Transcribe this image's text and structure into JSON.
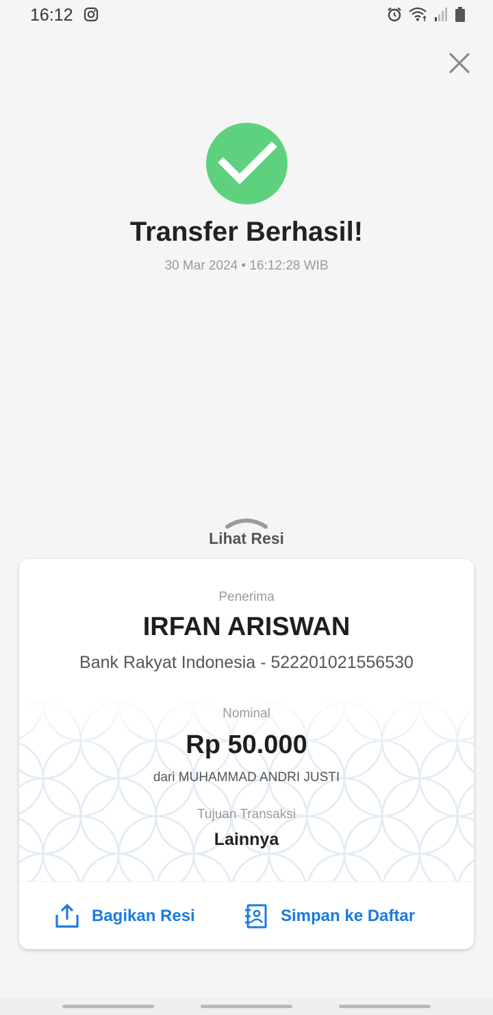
{
  "status_bar": {
    "time": "16:12",
    "icons": [
      "instagram-icon",
      "alarm-icon",
      "wifi-icon",
      "signal-icon",
      "battery-icon"
    ]
  },
  "header": {
    "close_icon": "close-icon"
  },
  "success": {
    "icon": "check-icon",
    "icon_color": "#5ed17f",
    "title": "Transfer Berhasil!",
    "datetime": "30 Mar 2024 • 16:12:28 WIB"
  },
  "receipt": {
    "toggle_label": "Lihat Resi",
    "recipient_label": "Penerima",
    "recipient_name": "IRFAN ARISWAN",
    "recipient_bank": "Bank Rakyat Indonesia - 522201021556530",
    "amount_label": "Nominal",
    "amount": "Rp 50.000",
    "from": "dari MUHAMMAD ANDRI JUSTI",
    "purpose_label": "Tujuan Transaksi",
    "purpose": "Lainnya"
  },
  "actions": {
    "share_label": "Bagikan Resi",
    "save_label": "Simpan ke Daftar",
    "accent": "#1a7be0"
  }
}
